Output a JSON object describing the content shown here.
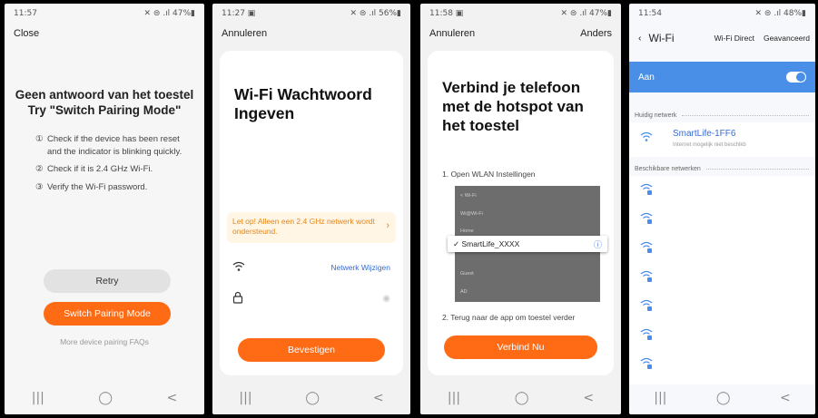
{
  "phone1": {
    "status": {
      "time": "11:57",
      "icons": "✕ ⊜ .ıl 47%▮"
    },
    "close": "Close",
    "title_line1": "Geen antwoord van het toestel",
    "title_line2": "Try \"Switch Pairing Mode\"",
    "checks": [
      {
        "num": "①",
        "text": "Check if the device has been reset and the indicator is blinking quickly."
      },
      {
        "num": "②",
        "text": "Check if it is 2.4 GHz Wi-Fi."
      },
      {
        "num": "③",
        "text": "Verify the Wi-Fi password."
      }
    ],
    "retry": "Retry",
    "switch_mode": "Switch Pairing Mode",
    "faq": "More device pairing FAQs"
  },
  "phone2": {
    "status": {
      "time": "11:27 ▣",
      "icons": "✕ ⊜ .ıl 56%▮"
    },
    "cancel": "Annuleren",
    "title": "Wi-Fi Wachtwoord Ingeven",
    "warning": "Let op! Alleen een 2.4 GHz netwerk wordt ondersteund.",
    "change_network": "Netwerk Wijzigen",
    "confirm": "Bevestigen"
  },
  "phone3": {
    "status": {
      "time": "11:58 ▣",
      "icons": "✕ ⊜ .ıl 47%▮"
    },
    "cancel": "Annuleren",
    "other": "Anders",
    "title": "Verbind je telefoon met de hotspot van het toestel",
    "step1": "1. Open WLAN Instellingen",
    "step2": "2. Terug naar de app om toestel verder",
    "screenshot_rows": [
      "< Wi-Fi",
      "Wi@Wi-Fi",
      "Home",
      "",
      "Guest",
      "AD"
    ],
    "hotspot_name": "✓  SmartLife_XXXX",
    "connect": "Verbind Nu"
  },
  "phone4": {
    "status": {
      "time": "11:54",
      "icons": "✕ ⊜ .ıl 48%▮"
    },
    "back_title": "Wi-Fi",
    "wifi_direct": "Wi-Fi Direct",
    "advanced": "Geavanceerd",
    "toggle_label": "Aan",
    "current_network_label": "Huidig netwerk",
    "current_ssid": "SmartLife-1FF6",
    "current_sub": "Internet mogelijk niet beschikb",
    "available_label": "Beschikbare netwerken"
  },
  "nav": {
    "recent": "|||",
    "home": "◯",
    "back": "<"
  }
}
